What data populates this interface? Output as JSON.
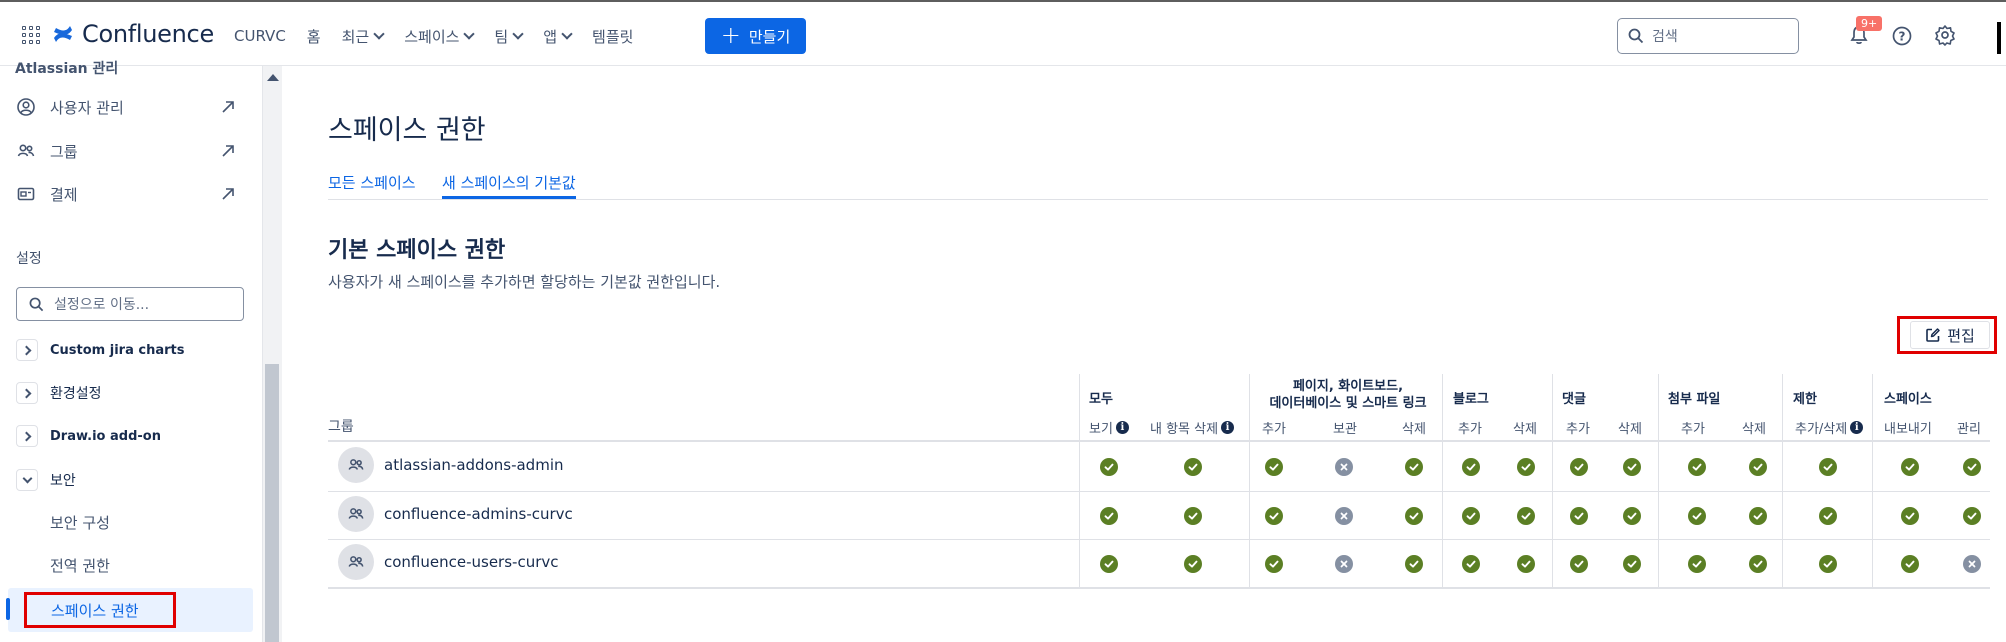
{
  "topbar": {
    "app_name": "Confluence",
    "nav": [
      {
        "label": "CURVC",
        "dropdown": false
      },
      {
        "label": "홈",
        "dropdown": false
      },
      {
        "label": "최근",
        "dropdown": true
      },
      {
        "label": "스페이스",
        "dropdown": true
      },
      {
        "label": "팀",
        "dropdown": true
      },
      {
        "label": "앱",
        "dropdown": true
      },
      {
        "label": "템플릿",
        "dropdown": false
      }
    ],
    "create_label": "만들기",
    "search_placeholder": "검색",
    "notification_badge": "9+",
    "icons": [
      "app-switcher-icon",
      "bell-icon",
      "help-icon",
      "gear-icon"
    ]
  },
  "sidebar": {
    "cut_heading": "Atlassian 관리",
    "admin_links": [
      {
        "label": "사용자 관리",
        "icon": "user-circle-icon"
      },
      {
        "label": "그룹",
        "icon": "people-icon"
      },
      {
        "label": "결제",
        "icon": "billing-icon"
      }
    ],
    "settings_heading": "설정",
    "settings_search_placeholder": "설정으로 이동...",
    "tree": [
      {
        "label": "Custom jira charts",
        "expanded": false
      },
      {
        "label": "환경설정",
        "expanded": false
      },
      {
        "label": "Draw.io add-on",
        "expanded": false
      },
      {
        "label": "보안",
        "expanded": true
      }
    ],
    "security_children": [
      "보안 구성",
      "전역 권한",
      "스페이스 권한"
    ],
    "active_item": "스페이스 권한"
  },
  "main": {
    "page_title": "스페이스 권한",
    "tabs": [
      {
        "label": "모든 스페이스",
        "active": false
      },
      {
        "label": "새 스페이스의 기본값",
        "active": true
      }
    ],
    "section_title": "기본 스페이스 권한",
    "section_desc": "사용자가 새 스페이스를 추가하면 할당하는 기본값 권한입니다.",
    "edit_label": "편집",
    "table": {
      "group_col": "그룹",
      "groups": [
        {
          "label": "모두",
          "subs": [
            {
              "label": "보기",
              "info": true
            },
            {
              "label": "내 항목 삭제",
              "info": true
            }
          ]
        },
        {
          "label_line1": "페이지, 화이트보드,",
          "label_line2": "데이터베이스 및 스마트 링크",
          "subs": [
            {
              "label": "추가"
            },
            {
              "label": "보관"
            },
            {
              "label": "삭제"
            }
          ]
        },
        {
          "label": "블로그",
          "subs": [
            {
              "label": "추가"
            },
            {
              "label": "삭제"
            }
          ]
        },
        {
          "label": "댓글",
          "subs": [
            {
              "label": "추가"
            },
            {
              "label": "삭제"
            }
          ]
        },
        {
          "label": "첨부 파일",
          "subs": [
            {
              "label": "추가"
            },
            {
              "label": "삭제"
            }
          ]
        },
        {
          "label": "제한",
          "subs": [
            {
              "label": "추가/삭제",
              "info": true
            }
          ]
        },
        {
          "label": "스페이스",
          "subs": [
            {
              "label": "내보내기"
            },
            {
              "label": "관리"
            }
          ]
        }
      ],
      "rows": [
        {
          "name": "atlassian-addons-admin",
          "perms": [
            true,
            true,
            true,
            false,
            true,
            true,
            true,
            true,
            true,
            true,
            true,
            true,
            true,
            true
          ]
        },
        {
          "name": "confluence-admins-curvc",
          "perms": [
            true,
            true,
            true,
            false,
            true,
            true,
            true,
            true,
            true,
            true,
            true,
            true,
            true,
            true
          ]
        },
        {
          "name": "confluence-users-curvc",
          "perms": [
            true,
            true,
            true,
            false,
            true,
            true,
            true,
            true,
            true,
            true,
            true,
            true,
            true,
            false
          ]
        }
      ]
    }
  },
  "colors": {
    "brand_blue": "#0c66e4",
    "granted_green": "#5b7f24",
    "denied_gray": "#8590a2",
    "highlight_red": "#e00000"
  }
}
